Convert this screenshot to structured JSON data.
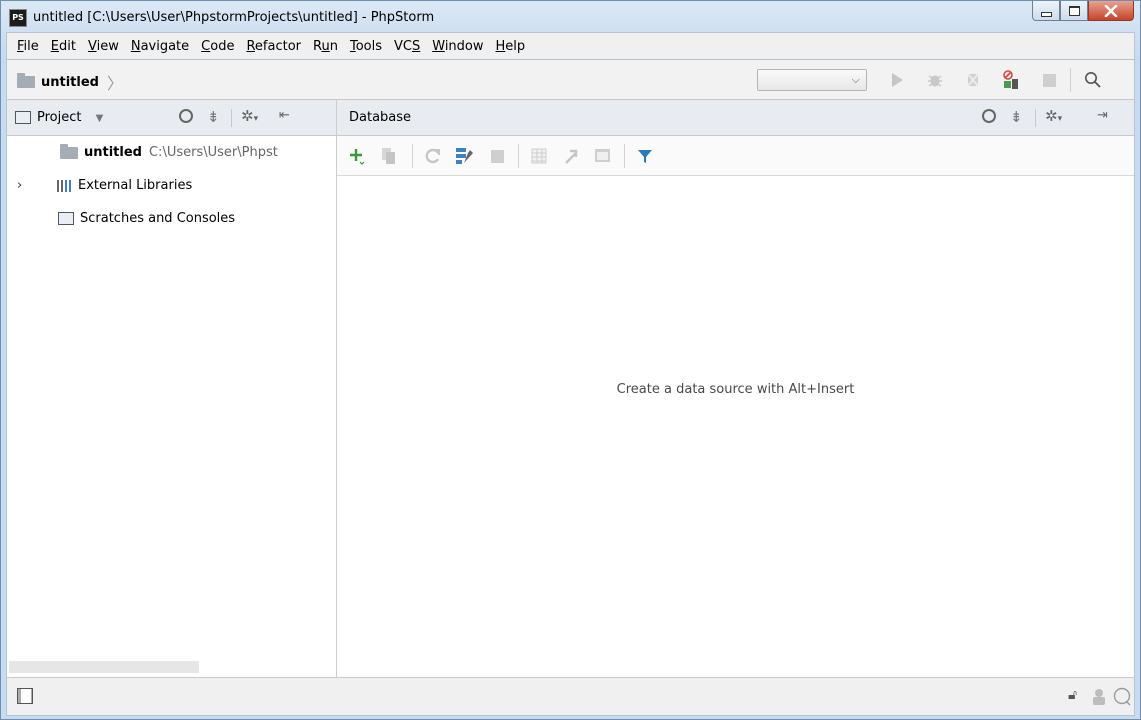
{
  "window": {
    "app_icon": "PS",
    "title": "untitled [C:\\Users\\User\\PhpstormProjects\\untitled] - PhpStorm",
    "controls": [
      "minimize-icon",
      "maximize-icon",
      "close-icon"
    ]
  },
  "menu": {
    "items": [
      {
        "mnemonic": "F",
        "rest": "ile"
      },
      {
        "mnemonic": "E",
        "rest": "dit"
      },
      {
        "mnemonic": "V",
        "rest": "iew"
      },
      {
        "mnemonic": "N",
        "rest": "avigate"
      },
      {
        "mnemonic": "C",
        "rest": "ode"
      },
      {
        "mnemonic": "R",
        "rest": "efactor"
      },
      {
        "pre": "R",
        "mnemonic": "u",
        "rest": "n"
      },
      {
        "mnemonic": "T",
        "rest": "ools"
      },
      {
        "pre": "VC",
        "mnemonic": "S",
        "rest": ""
      },
      {
        "mnemonic": "W",
        "rest": "indow"
      },
      {
        "mnemonic": "H",
        "rest": "elp"
      }
    ]
  },
  "navbar": {
    "breadcrumb": "untitled",
    "run_config_value": "",
    "icons": [
      "run-icon",
      "debug-icon",
      "coverage-icon",
      "attach-icon",
      "stop-icon",
      "search-icon"
    ]
  },
  "project_panel": {
    "title": "Project",
    "header_icons": [
      "locate-icon",
      "collapse-icon",
      "settings-icon",
      "hide-icon"
    ],
    "tree": [
      {
        "name": "untitled",
        "path": "C:\\Users\\User\\Phpst",
        "icon": "folder-icon"
      },
      {
        "name": "External Libraries",
        "icon": "libraries-icon",
        "expandable": true
      },
      {
        "name": "Scratches and Consoles",
        "icon": "scratches-icon"
      }
    ]
  },
  "database_panel": {
    "title": "Database",
    "header_icons": [
      "locate-icon",
      "collapse-icon",
      "settings-icon",
      "hide-icon"
    ],
    "toolbar_icons": [
      "add-icon",
      "copy-icon",
      "refresh-icon",
      "properties-icon",
      "stop-icon",
      "table-icon",
      "jump-icon",
      "console-icon",
      "filter-icon"
    ],
    "empty_message": "Create a data source with Alt+Insert"
  },
  "statusbar": {
    "icons": [
      "tool-windows-icon",
      "lock-icon",
      "inspector-icon",
      "event-log-icon"
    ]
  },
  "colors": {
    "accent_green": "#3a9a3a",
    "filter_blue": "#2a7ab8",
    "close_red": "#c7432a"
  }
}
